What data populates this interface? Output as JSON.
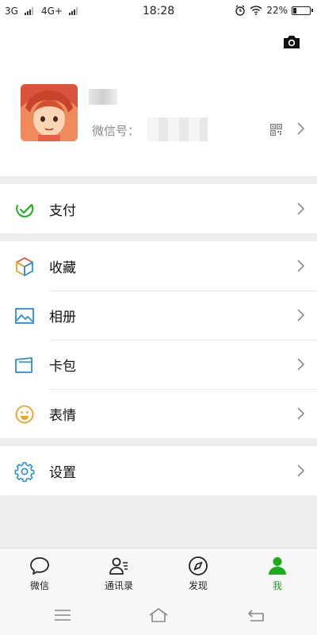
{
  "status_bar": {
    "carrier1": "3G",
    "carrier2": "4G+",
    "time": "18:28",
    "battery_text": "22%",
    "battery_level": 0.22,
    "icons": [
      "signal-icon",
      "alarm-icon",
      "wifi-icon",
      "battery-icon"
    ]
  },
  "profile": {
    "wechat_id_label": "微信号：",
    "icons": [
      "camera-icon",
      "qr-code-icon",
      "chevron-right-icon"
    ]
  },
  "menu": {
    "pay": {
      "label": "支付",
      "icon": "wallet-check-icon",
      "color": "#1aad19"
    },
    "favorites": {
      "label": "收藏",
      "icon": "cube-icon"
    },
    "album": {
      "label": "相册",
      "icon": "image-icon",
      "color": "#2a8fd6"
    },
    "cards": {
      "label": "卡包",
      "icon": "card-wallet-icon",
      "color": "#2a8fd6"
    },
    "stickers": {
      "label": "表情",
      "icon": "smiley-icon",
      "color": "#f0a020"
    },
    "settings": {
      "label": "设置",
      "icon": "gear-icon",
      "color": "#2a8fd6"
    }
  },
  "tabs": [
    {
      "label": "微信",
      "icon": "chat-bubble-icon"
    },
    {
      "label": "通讯录",
      "icon": "contacts-icon"
    },
    {
      "label": "发现",
      "icon": "compass-icon"
    },
    {
      "label": "我",
      "icon": "person-icon",
      "active": true
    }
  ],
  "colors": {
    "accent": "#1aad19",
    "background": "#ededed"
  }
}
